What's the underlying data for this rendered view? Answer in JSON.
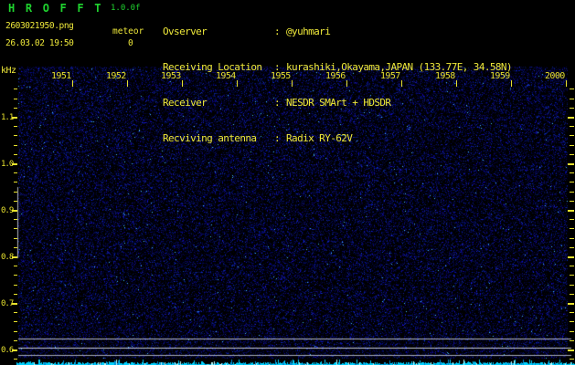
{
  "header": {
    "title": "H R O F F T",
    "version": "1.0.0f",
    "filename": "2603021950.png",
    "counter_label": "meteor",
    "counter_value": "0",
    "timestamp": "26.03.02 19:50",
    "separator": ":",
    "title_color": "#1fd32f",
    "text_color": "#efe93a",
    "info_rows": [
      {
        "label": "Ovserver",
        "value": "@yuhmari"
      },
      {
        "label": "Receiving Location",
        "value": "kurashiki,Okayama,JAPAN (133.77E, 34.58N)"
      },
      {
        "label": "Receiver",
        "value": "NESDR SMArt + HDSDR"
      },
      {
        "label": "Recviving antenna",
        "value": "Radix RY-62V"
      }
    ]
  },
  "spectrogram": {
    "unit_label": "kHz",
    "time_labels": [
      "1951",
      "1952",
      "1953",
      "1954",
      "1955",
      "1956",
      "1957",
      "1958",
      "1959",
      "2000"
    ],
    "freq_major_labels": [
      "1.1",
      "1.0",
      "0.9",
      "0.8",
      "0.7",
      "0.6"
    ],
    "freq_axis_khz": {
      "major_step": 0.1,
      "minor_step": 0.02,
      "labeled_range": [
        0.6,
        1.1
      ]
    },
    "axis_color": "#e8e22e",
    "noise_dot_color": "#2233bb",
    "carrier_lines": {
      "rows_y": [
        371,
        381,
        389
      ],
      "color": "#b8bcc8"
    },
    "calibration_vline": {
      "present": true,
      "color": "#b0b4bc"
    },
    "level_strip_color": "#00dcff"
  }
}
